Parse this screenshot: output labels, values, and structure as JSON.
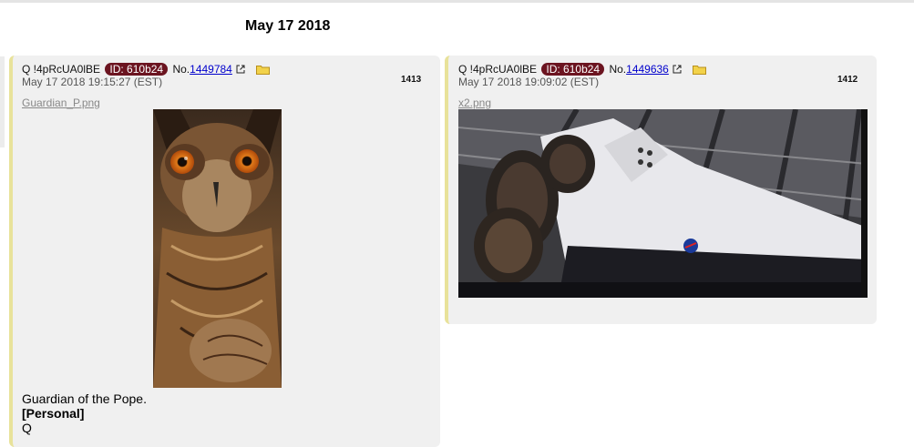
{
  "date_heading": "May 17 2018",
  "posts": [
    {
      "author": "Q !4pRcUA0lBE",
      "id_badge": "ID: 610b24",
      "no_label": "No.",
      "post_number": "1449784",
      "timestamp": "May 17 2018 19:15:27 (EST)",
      "count": "1413",
      "filename": "Guardian_P.png",
      "image_subject": "owl",
      "body": [
        "Guardian of the Pope.",
        "[Personal]",
        "Q"
      ]
    },
    {
      "author": "Q !4pRcUA0lBE",
      "id_badge": "ID: 610b24",
      "no_label": "No.",
      "post_number": "1449636",
      "timestamp": "May 17 2018 19:09:02 (EST)",
      "count": "1412",
      "filename": "x2.png",
      "image_subject": "space-shuttle"
    }
  ],
  "colors": {
    "id_badge_bg": "#6b1420",
    "post_border": "#e8e29a",
    "post_bg": "#f0f0f0",
    "link": "#0000cc"
  }
}
